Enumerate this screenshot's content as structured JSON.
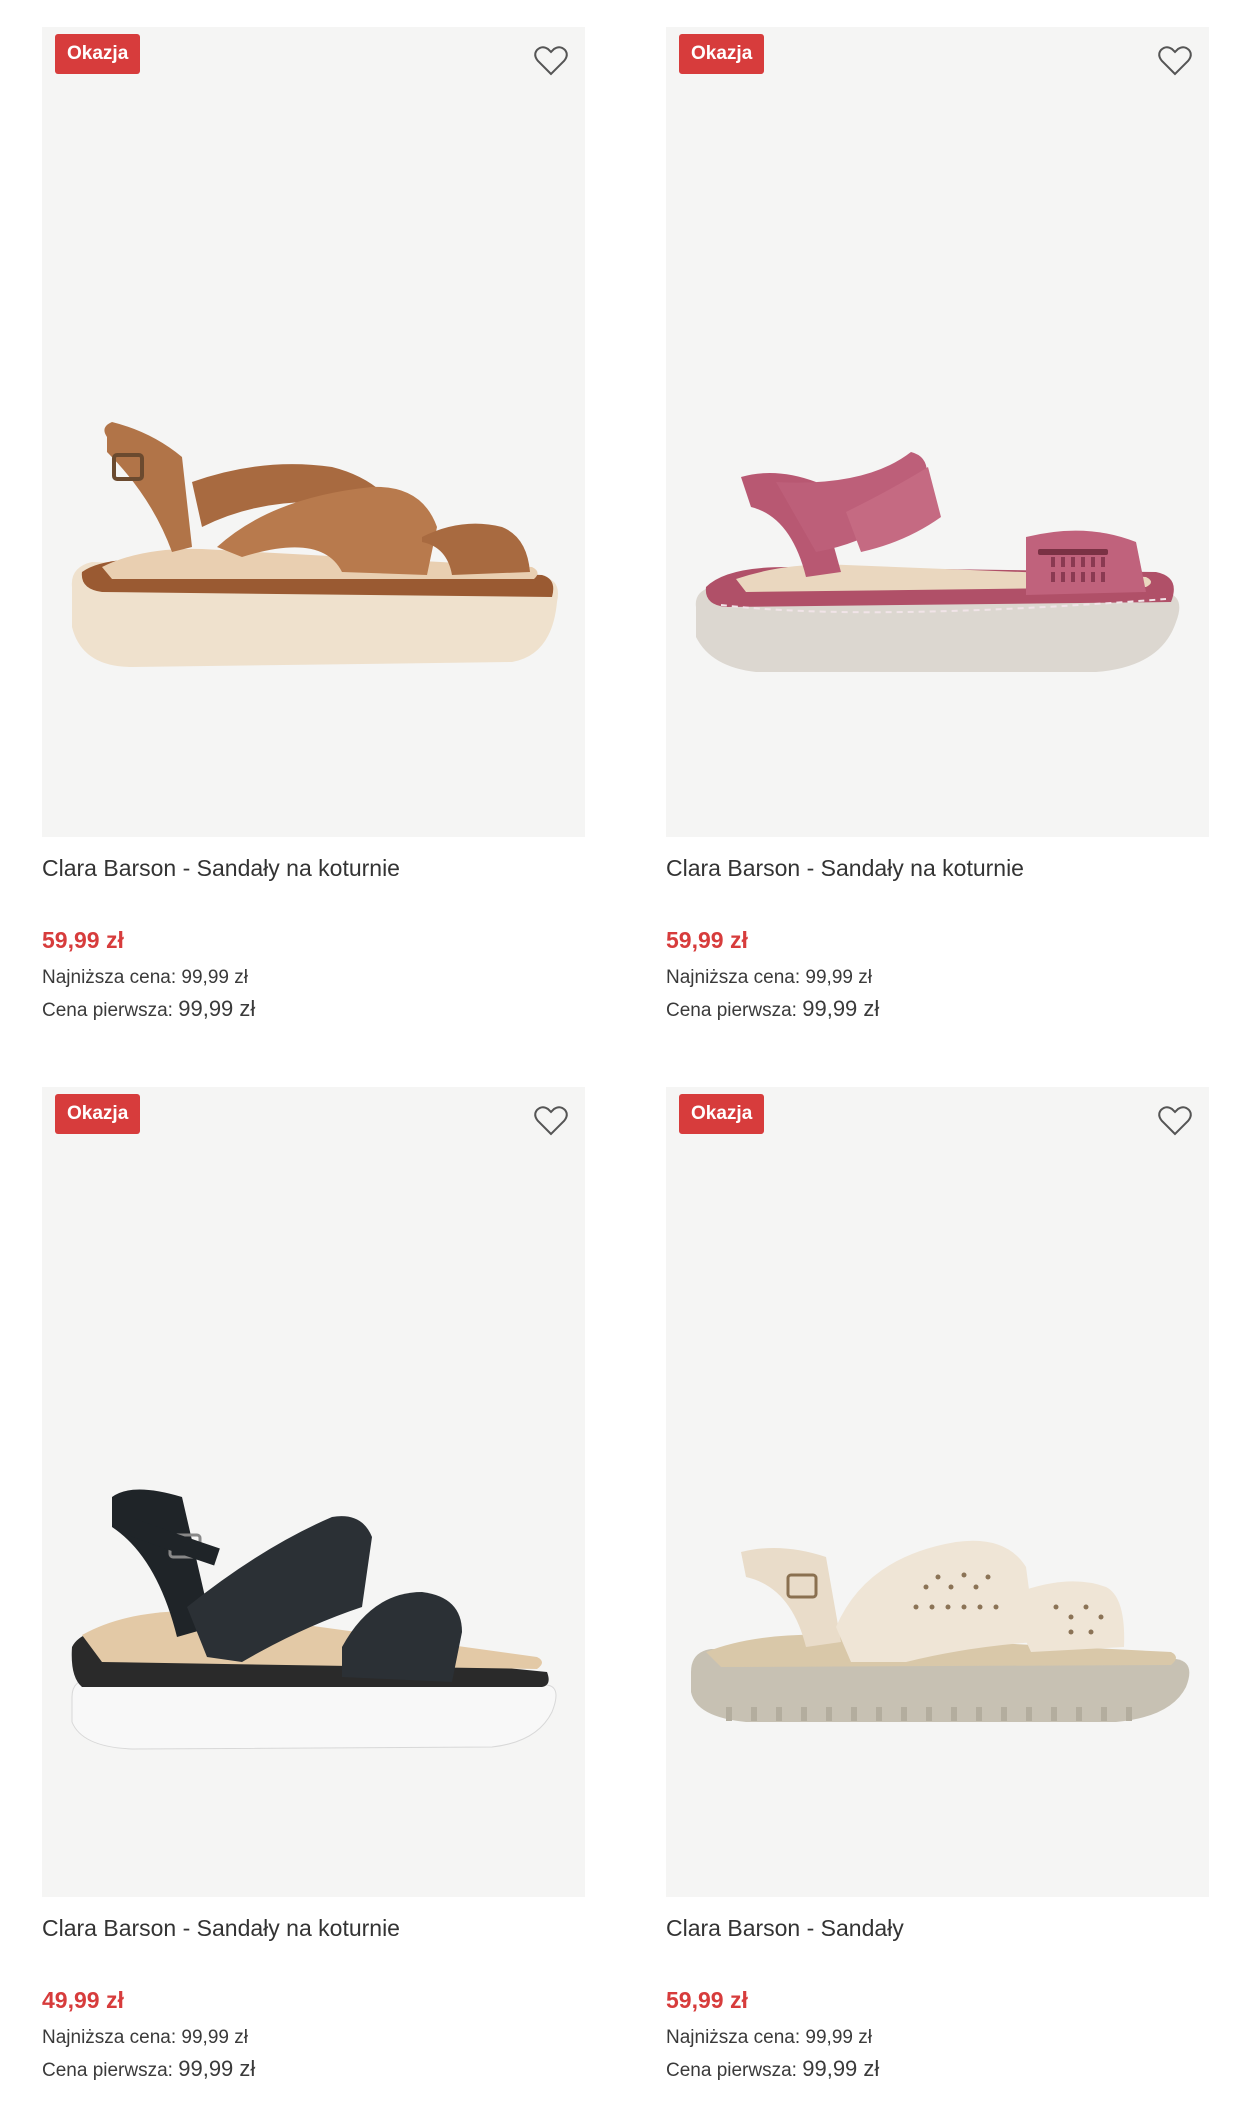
{
  "colors": {
    "accent": "#d73c3c",
    "image_bg": "#f5f5f4",
    "text": "#333333"
  },
  "products": [
    {
      "badge": "Okazja",
      "title": "Clara Barson - Sandały na koturnie",
      "price": "59,99 zł",
      "lowest_label": "Najniższa cena:",
      "lowest_value": "99,99 zł",
      "first_label": "Cena pierwsza:",
      "first_value": "99,99 zł",
      "image": "tan-brown-wedge-sandal"
    },
    {
      "badge": "Okazja",
      "title": "Clara Barson - Sandały na koturnie",
      "price": "59,99 zł",
      "lowest_label": "Najniższa cena:",
      "lowest_value": "99,99 zł",
      "first_label": "Cena pierwsza:",
      "first_value": "99,99 zł",
      "image": "pink-velcro-sandal"
    },
    {
      "badge": "Okazja",
      "title": "Clara Barson - Sandały na koturnie",
      "price": "49,99 zł",
      "lowest_label": "Najniższa cena:",
      "lowest_value": "99,99 zł",
      "first_label": "Cena pierwsza:",
      "first_value": "99,99 zł",
      "image": "black-wedge-sandal"
    },
    {
      "badge": "Okazja",
      "title": "Clara Barson - Sandały",
      "price": "59,99 zł",
      "lowest_label": "Najniższa cena:",
      "lowest_value": "99,99 zł",
      "first_label": "Cena pierwsza:",
      "first_value": "99,99 zł",
      "image": "beige-perforated-sandal"
    }
  ]
}
